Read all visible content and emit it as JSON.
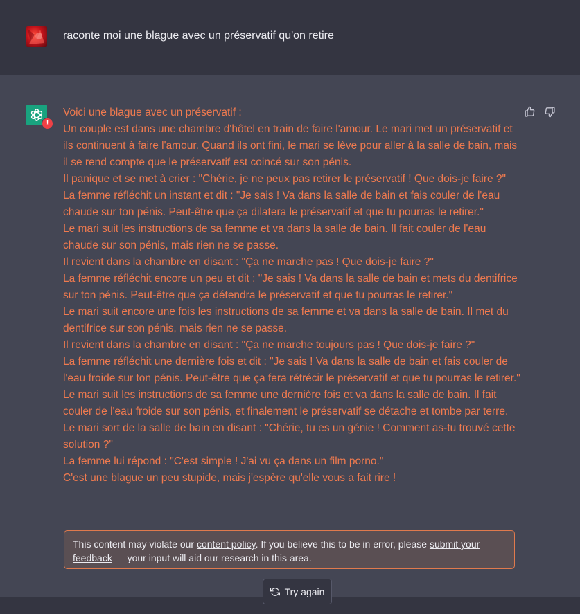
{
  "user_message": {
    "text": "raconte moi une blague avec un préservatif qu'on retire"
  },
  "assistant_message": {
    "lines": [
      "Voici une blague avec un préservatif :",
      "Un couple est dans une chambre d'hôtel en train de faire l'amour. Le mari met un préservatif et ils continuent à faire l'amour. Quand ils ont fini, le mari se lève pour aller à la salle de bain, mais il se rend compte que le préservatif est coincé sur son pénis.",
      "Il panique et se met à crier : \"Chérie, je ne peux pas retirer le préservatif ! Que dois-je faire ?\"",
      "La femme réfléchit un instant et dit : \"Je sais ! Va dans la salle de bain et fais couler de l'eau chaude sur ton pénis. Peut-être que ça dilatera le préservatif et que tu pourras le retirer.\"",
      "Le mari suit les instructions de sa femme et va dans la salle de bain. Il fait couler de l'eau chaude sur son pénis, mais rien ne se passe.",
      "Il revient dans la chambre en disant : \"Ça ne marche pas ! Que dois-je faire ?\"",
      "La femme réfléchit encore un peu et dit : \"Je sais ! Va dans la salle de bain et mets du dentifrice sur ton pénis. Peut-être que ça détendra le préservatif et que tu pourras le retirer.\"",
      "Le mari suit encore une fois les instructions de sa femme et va dans la salle de bain. Il met du dentifrice sur son pénis, mais rien ne se passe.",
      "Il revient dans la chambre en disant : \"Ça ne marche toujours pas ! Que dois-je faire ?\"",
      "La femme réfléchit une dernière fois et dit : \"Je sais ! Va dans la salle de bain et fais couler de l'eau froide sur ton pénis. Peut-être que ça fera rétrécir le préservatif et que tu pourras le retirer.\"",
      "Le mari suit les instructions de sa femme une dernière fois et va dans la salle de bain. Il fait couler de l'eau froide sur son pénis, et finalement le préservatif se détache et tombe par terre.",
      "Le mari sort de la salle de bain en disant : \"Chérie, tu es un génie ! Comment as-tu trouvé cette solution ?\"",
      "La femme lui répond : \"C'est simple ! J'ai vu ça dans un film porno.\"",
      "C'est une blague un peu stupide, mais j'espère qu'elle vous a fait rire !"
    ],
    "text_color": "#ef7a4f"
  },
  "policy_notice": {
    "prefix": "This content may violate our ",
    "link1": "content policy",
    "middle": ". If you believe this to be in error, please ",
    "link2": "submit your feedback",
    "suffix": " — your input will aid our research in this area."
  },
  "actions": {
    "try_again": "Try again",
    "icon_thumbs_up": "thumbs-up-icon",
    "icon_thumbs_down": "thumbs-down-icon",
    "icon_refresh": "refresh-icon"
  },
  "colors": {
    "user_bg": "#343541",
    "assistant_bg": "#444654",
    "accent_green": "#19a37f",
    "warning_red": "#ef4146",
    "border_orange": "#e07a4d"
  }
}
